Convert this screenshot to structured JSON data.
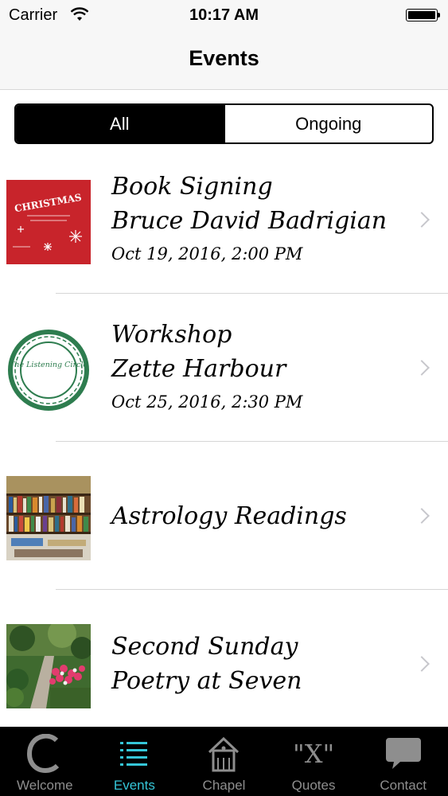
{
  "status_bar": {
    "carrier": "Carrier",
    "time": "10:17 AM"
  },
  "nav": {
    "title": "Events"
  },
  "segmented": {
    "all": "All",
    "ongoing": "Ongoing"
  },
  "events": [
    {
      "line1": "Book Signing",
      "line2": "Bruce David Badrigian",
      "date": "Oct 19, 2016, 2:00 PM",
      "thumb_text": "CHRISTMAS"
    },
    {
      "line1": "Workshop",
      "line2": "Zette Harbour",
      "date": "Oct 25, 2016, 2:30 PM",
      "thumb_text": "The Listening Circle"
    },
    {
      "line1": "Astrology Readings"
    },
    {
      "line1": "Second Sunday",
      "line2": "Poetry at Seven"
    }
  ],
  "tabs": [
    {
      "label": "Welcome",
      "icon": "c-logo-icon"
    },
    {
      "label": "Events",
      "icon": "list-icon",
      "active": true
    },
    {
      "label": "Chapel",
      "icon": "house-icon"
    },
    {
      "label": "Quotes",
      "icon": "quote-x-icon"
    },
    {
      "label": "Contact",
      "icon": "speech-bubble-icon"
    }
  ],
  "colors": {
    "active_tab": "#35c6d8",
    "inactive_tab": "#8e8e8e",
    "tab_bar_bg": "#000000"
  }
}
